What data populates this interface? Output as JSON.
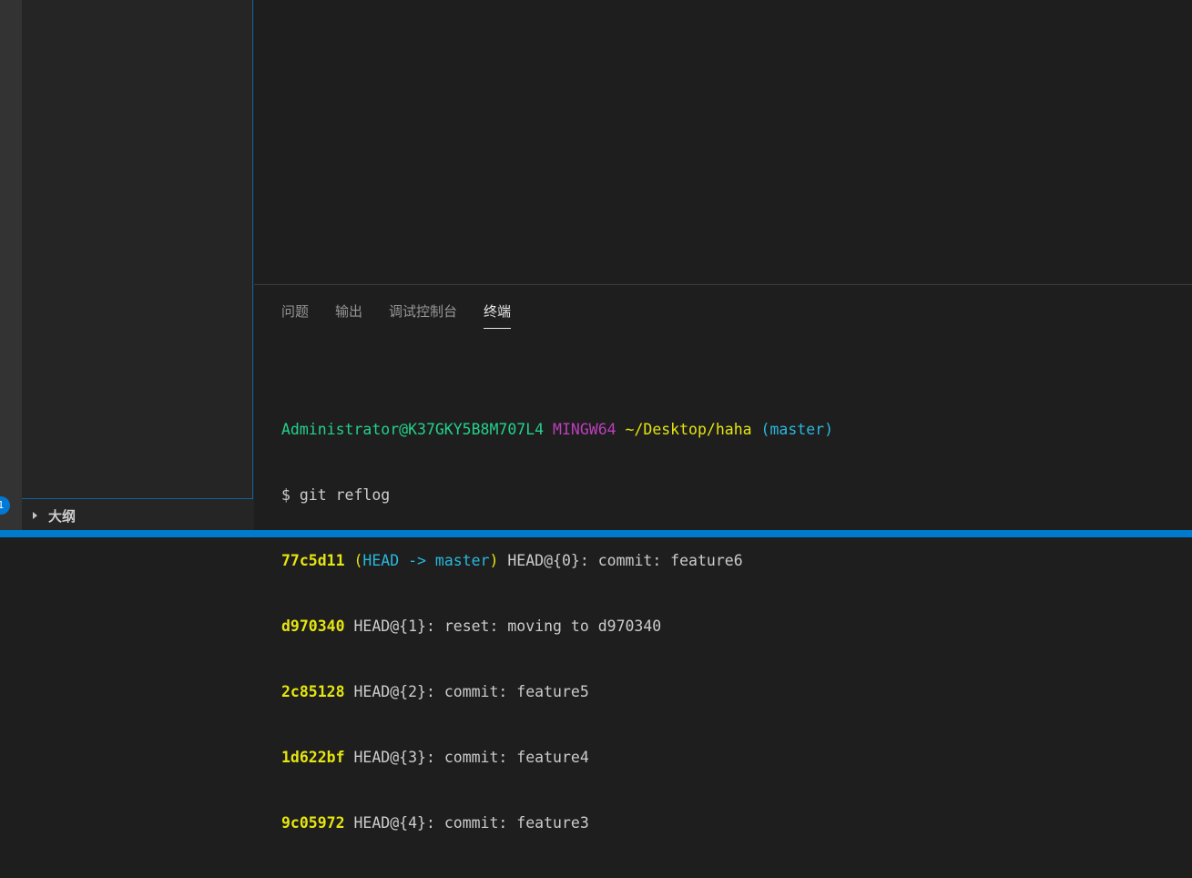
{
  "activity_bar": {
    "badge": "1"
  },
  "sidebar": {
    "outline_label": "大纲"
  },
  "panel": {
    "tabs": [
      {
        "label": "问题"
      },
      {
        "label": "输出"
      },
      {
        "label": "调试控制台"
      },
      {
        "label": "终端",
        "active": true
      }
    ]
  },
  "terminal": {
    "prompt": {
      "user_host": "Administrator@K37GKY5B8M707L4",
      "system": "MINGW64",
      "path": "~/Desktop/haha",
      "branch": "(master)"
    },
    "command": "$ git reflog",
    "head_ref": {
      "open": "(",
      "head": "HEAD -> master",
      "close": ")"
    },
    "entries": [
      {
        "hash": "77c5d11",
        "text": "HEAD@{0}: commit: feature6"
      },
      {
        "hash": "d970340",
        "text": "HEAD@{1}: reset: moving to d970340"
      },
      {
        "hash": "2c85128",
        "text": "HEAD@{2}: commit: feature5"
      },
      {
        "hash": "1d622bf",
        "text": "HEAD@{3}: commit: feature4"
      },
      {
        "hash": "9c05972",
        "text": "HEAD@{4}: commit: feature3"
      }
    ]
  },
  "colors": {
    "accent": "#007acc",
    "terminal_green": "#23d18b",
    "terminal_magenta": "#bc3fbc",
    "terminal_yellow": "#e5e510",
    "terminal_cyan": "#29b8db"
  }
}
